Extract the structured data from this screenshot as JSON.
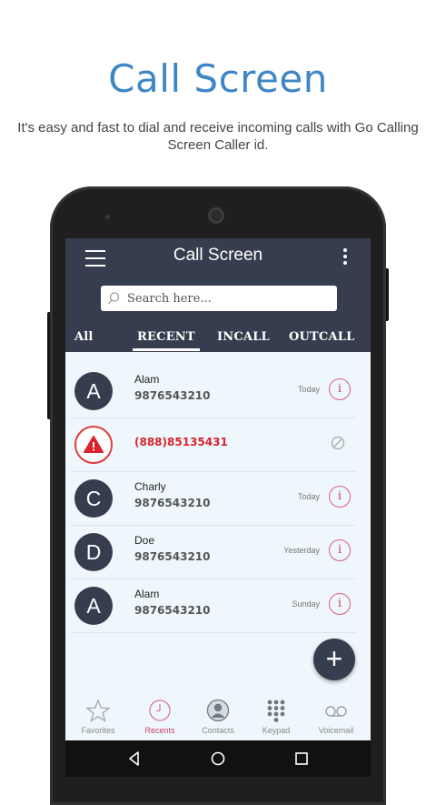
{
  "promo": {
    "title": "Call Screen",
    "subtitle": "It's easy and fast to dial and receive incoming calls with Go Calling Screen Caller id."
  },
  "app": {
    "title": "Call Screen",
    "search_placeholder": "Search here...",
    "tabs": [
      {
        "label": "All"
      },
      {
        "label": "RECENT",
        "active": true
      },
      {
        "label": "INCALL"
      },
      {
        "label": "OUTCALL"
      }
    ],
    "calls": [
      {
        "initial": "A",
        "name": "Alam",
        "number": "9876543210",
        "when": "Today",
        "icon": "info-icon"
      },
      {
        "initial": "",
        "name": "",
        "number": "(888)85135431",
        "when": "",
        "icon": "block-icon",
        "alert": true
      },
      {
        "initial": "C",
        "name": "Charly",
        "number": "9876543210",
        "when": "Today",
        "icon": "info-icon"
      },
      {
        "initial": "D",
        "name": "Doe",
        "number": "9876543210",
        "when": "Yesterday",
        "icon": "info-icon"
      },
      {
        "initial": "A",
        "name": "Alam",
        "number": "9876543210",
        "when": "Sunday",
        "icon": "info-icon"
      }
    ],
    "fab_label": "+",
    "bottom_nav": [
      {
        "label": "Favorites",
        "icon": "star-icon"
      },
      {
        "label": "Recents",
        "icon": "clock-icon",
        "active": true
      },
      {
        "label": "Contacts",
        "icon": "contacts-icon"
      },
      {
        "label": "Keypad",
        "icon": "keypad-icon"
      },
      {
        "label": "Voicemail",
        "icon": "voicemail-icon"
      }
    ],
    "colors": {
      "primary": "#363d4e",
      "accent": "#cc3f71",
      "alert": "#d9232e",
      "promo_title": "#3f86c6",
      "list_bg": "#eef7fb"
    }
  }
}
